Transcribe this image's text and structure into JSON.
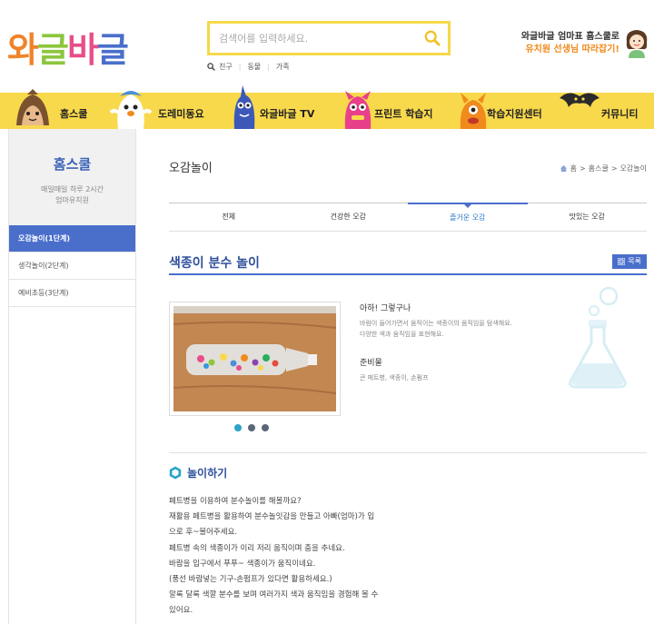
{
  "header": {
    "logo_chars": [
      "와",
      "글",
      "바",
      "글"
    ],
    "logo_colors": [
      "#f0832a",
      "#8cc63e",
      "#e84d8a",
      "#4a6fcb"
    ],
    "search": {
      "placeholder": "검색어를 입력하세요."
    },
    "popular": [
      "친구",
      "동물",
      "가족"
    ],
    "promo_line1": "와글바글 엄마표 홈스쿨로",
    "promo_line2": "유치원 선생님 따라잡기!"
  },
  "nav": [
    {
      "label": "홈스쿨",
      "icon": "hedgehog-character-icon"
    },
    {
      "label": "도레미동요",
      "icon": "ghost-character-icon"
    },
    {
      "label": "와글바글 TV",
      "icon": "blue-monster-icon"
    },
    {
      "label": "프린트 학습지",
      "icon": "pink-monster-icon"
    },
    {
      "label": "학습지원센터",
      "icon": "orange-monster-icon"
    },
    {
      "label": "커뮤니티",
      "icon": "bat-character-icon"
    }
  ],
  "sidebar": {
    "title": "홈스쿨",
    "desc1": "매일매일 하루 2시간",
    "desc2": "엄마유치원",
    "items": [
      {
        "label": "오감놀이(1단계)",
        "active": true
      },
      {
        "label": "생각놀이(2단계)",
        "active": false
      },
      {
        "label": "예비초등(3단계)",
        "active": false
      }
    ]
  },
  "content": {
    "page_title": "오감놀이",
    "breadcrumb": [
      "홈",
      "홈스쿨",
      "오감놀이"
    ],
    "tabs": [
      {
        "label": "전체",
        "active": false
      },
      {
        "label": "건강한 오감",
        "active": false
      },
      {
        "label": "즐거운 오감",
        "active": true
      },
      {
        "label": "맛있는 오감",
        "active": false
      }
    ],
    "item_title": "색종이 분수 놀이",
    "list_button": "목록",
    "info_heading": "아하! 그렇구나",
    "info_text1": "바람이 들어가면서 움직이는 색종이의 움직임을 탐색해요.",
    "info_text2": "다양한 색과 움직임을 표현해요.",
    "prep_heading": "준비물",
    "prep_text": "큰 페트병, 색종이, 손펌프",
    "carousel_active_index": 0,
    "carousel_count": 3,
    "section_title": "놀이하기",
    "body_lines": [
      "페트병을 이용하여 분수놀이를 해볼까요?",
      "재활용 페트병을 활용하여 분수놀잇감을 만들고 아빠(엄마)가 입",
      "으로 후~불어주세요.",
      "페트병 속의 색종이가 이리 저리 움직이며 춤을 추네요.",
      "바람을 입구에서 푸푸~ 색종이가 움직이네요.",
      "(풍선 바람넣는 기구-손펌프가 있다면 활용하세요.)",
      "알록 달록 색깔 분수를 보며 여러가지 색과 움직임을 경험해 볼 수",
      "있어요."
    ]
  },
  "colors": {
    "nav_bg": "#f9d94c",
    "accent_blue": "#4a6fcb",
    "search_border": "#f5d94a",
    "promo_orange": "#f08a1c"
  }
}
